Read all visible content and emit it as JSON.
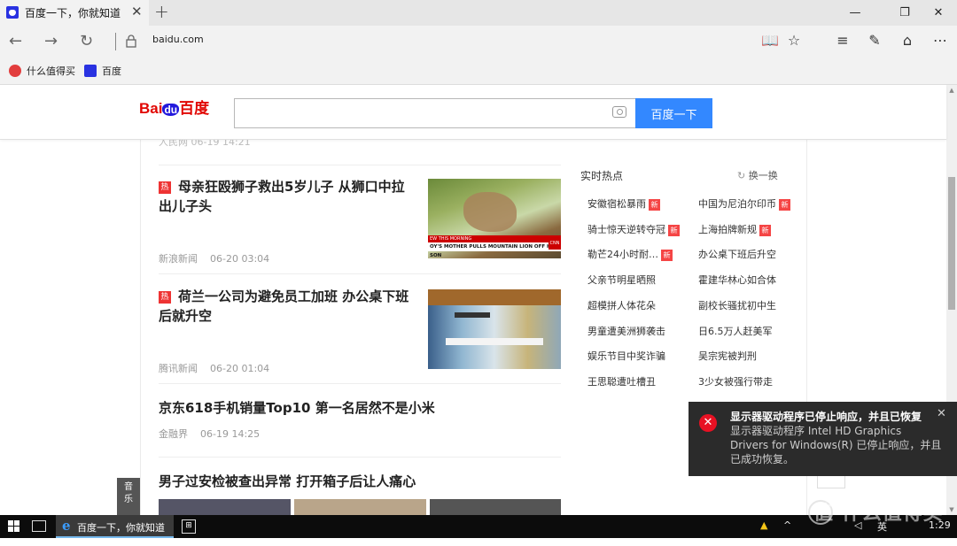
{
  "browser": {
    "tab_title": "百度一下，你就知道",
    "url": "baidu.com",
    "window_buttons": {
      "minimize": "—",
      "restore": "❐",
      "close": "✕"
    },
    "newtab": "+",
    "tab_close": "✕"
  },
  "favorites": [
    {
      "label": "什么值得买",
      "icon": "smzdm-icon",
      "color": "#e23d3d"
    },
    {
      "label": "百度",
      "icon": "baidu-paw-icon",
      "color": "#2932e1"
    }
  ],
  "search": {
    "logo_left": "Bai",
    "logo_mid": "du",
    "logo_right": "百度",
    "button_label": "百度一下",
    "value": ""
  },
  "scrolled_meta": "人民网 06-19 14:21",
  "news": [
    {
      "hot": "热",
      "title": "母亲狂殴狮子救出5岁儿子 从狮口中拉出儿子头",
      "source": "新浪新闻",
      "time": "06-20 03:04",
      "thumb_caption": "OY'S MOTHER PULLS MOUNTAIN LION OFF HER SON",
      "thumb_tag": "CNN"
    },
    {
      "hot": "热",
      "title": "荷兰一公司为避免员工加班 办公桌下班后就升空",
      "source": "腾讯新闻",
      "time": "06-20 01:04"
    },
    {
      "title": "京东618手机销量Top10 第一名居然不是小米",
      "source": "金融界",
      "time": "06-19 14:25"
    },
    {
      "title": "男子过安检被查出异常 打开箱子后让人痛心"
    }
  ],
  "hotlist": {
    "title": "实时热点",
    "refresh": "换一换",
    "new_badge": "新",
    "left": [
      {
        "text": "安徽宿松暴雨",
        "new": true
      },
      {
        "text": "骑士惊天逆转夺冠",
        "new": true
      },
      {
        "text": "勒芒24小时耐…",
        "new": true
      },
      {
        "text": "父亲节明星晒照",
        "new": false
      },
      {
        "text": "超模拼人体花朵",
        "new": false
      },
      {
        "text": "男童遭美洲狮袭击",
        "new": false
      },
      {
        "text": "娱乐节目中奖诈骗",
        "new": false
      },
      {
        "text": "王思聪遭吐槽丑",
        "new": false
      }
    ],
    "right": [
      {
        "text": "中国为尼泊尔印币",
        "new": true
      },
      {
        "text": "上海拍牌新规",
        "new": true
      },
      {
        "text": "办公桌下班后升空",
        "new": false
      },
      {
        "text": "霍建华林心如合体",
        "new": false
      },
      {
        "text": "副校长骚扰初中生",
        "new": false
      },
      {
        "text": "日6.5万人赶美军",
        "new": false
      },
      {
        "text": "吴宗宪被判刑",
        "new": false
      },
      {
        "text": "3少女被强行带走",
        "new": false
      }
    ]
  },
  "side_tab": "音乐",
  "toast": {
    "title": "显示器驱动程序已停止响应，并且已恢复",
    "body": "显示器驱动程序 Intel HD Graphics Drivers for Windows(R) 已停止响应，并且已成功恢复。",
    "close": "✕",
    "icon": "✕"
  },
  "taskbar": {
    "edge_label": "百度一下，你就知道 -...",
    "tray_lang": "英",
    "tray_time": "1:29"
  },
  "watermark": "值 什么值得买",
  "colors": {
    "accent": "#3388ff",
    "hot": "#e33333",
    "toast_bg": "#2b2b2b",
    "error": "#e81123"
  }
}
